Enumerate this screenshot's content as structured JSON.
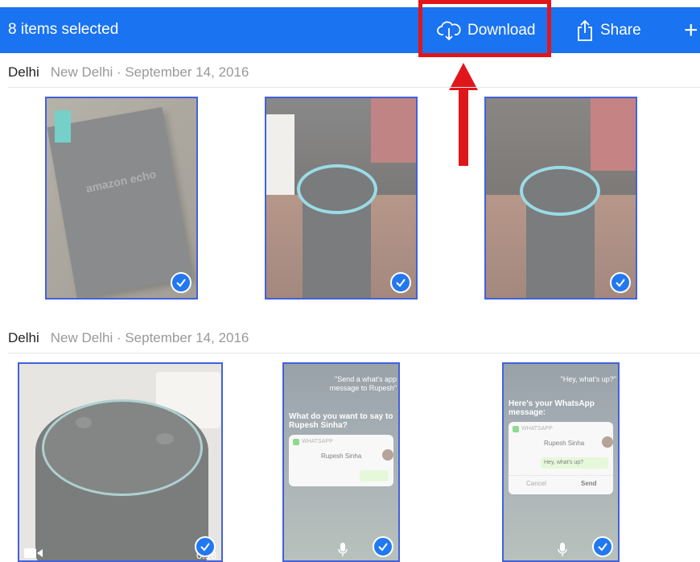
{
  "toolbar": {
    "selection_label": "8 items selected",
    "download_label": "Download",
    "share_label": "Share",
    "add_symbol": "+"
  },
  "colors": {
    "accent": "#1a73f0",
    "highlight": "#e0161a"
  },
  "sections": [
    {
      "place": "Delhi",
      "subtitle": "New Delhi · September 14, 2016"
    },
    {
      "place": "Delhi",
      "subtitle": "New Delhi · September 14, 2016"
    }
  ],
  "photos": [
    {
      "subject": "amazon echo box",
      "box_text": "amazon echo",
      "selected": true
    },
    {
      "subject": "echo speaker ring lit",
      "selected": true
    },
    {
      "subject": "echo speaker ring lit",
      "selected": true
    },
    {
      "subject": "echo dot top view",
      "video_duration": "0:18",
      "selected": true
    },
    {
      "subject": "siri whatsapp screenshot",
      "selected": true,
      "bubble": "\"Send a what's app message to Rupesh\"",
      "question": "What do you want to say to Rupesh Sinha?",
      "app": "WHATSAPP",
      "contact": "Rupesh Sinha"
    },
    {
      "subject": "siri whatsapp screenshot",
      "selected": true,
      "bubble": "\"Hey, what's up?\"",
      "question": "Here's your WhatsApp message:",
      "app": "WHATSAPP",
      "contact": "Rupesh Sinha",
      "message": "Hey, what's up?",
      "cancel": "Cancel",
      "send": "Send"
    }
  ]
}
